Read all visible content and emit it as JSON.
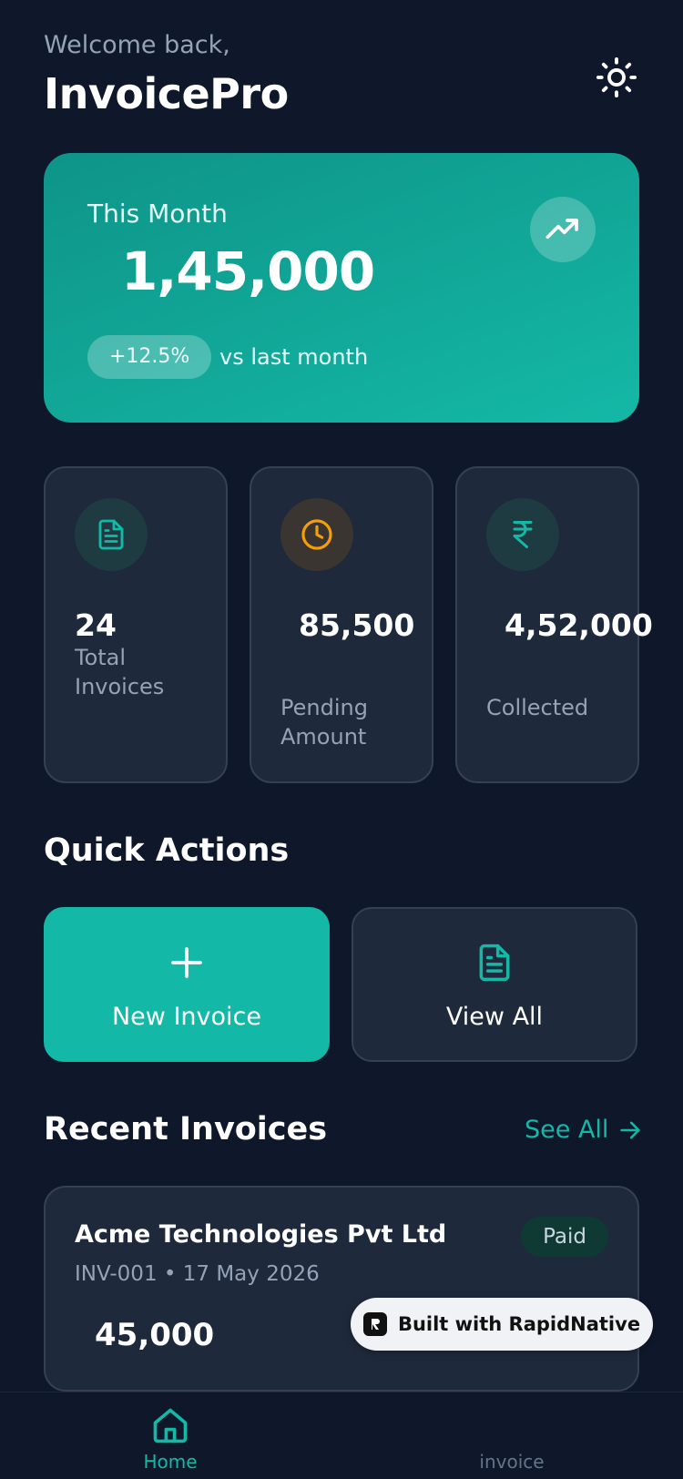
{
  "header": {
    "welcome": "Welcome back,",
    "title": "InvoicePro",
    "theme_icon": "sun-icon"
  },
  "hero": {
    "label": "This Month",
    "amount": "1,45,000",
    "change": "+12.5%",
    "compare": "vs last month",
    "icon": "trending-up-icon"
  },
  "stats": [
    {
      "value": "24",
      "label": "Total Invoices",
      "icon": "document-icon",
      "color": "#14b8a6"
    },
    {
      "value": "85,500",
      "label": "Pending Amount",
      "icon": "clock-icon",
      "color": "#f59e0b"
    },
    {
      "value": "4,52,000",
      "label": "Collected",
      "icon": "rupee-icon",
      "color": "#14b8a6"
    }
  ],
  "quick_actions": {
    "title": "Quick Actions",
    "new_invoice": "New Invoice",
    "view_all": "View All"
  },
  "recent": {
    "title": "Recent Invoices",
    "see_all": "See All",
    "invoices": [
      {
        "client": "Acme Technologies Pvt Ltd",
        "meta": "INV-001 • 17 May 2026",
        "amount": "45,000",
        "status": "Paid"
      }
    ]
  },
  "badge": {
    "text": "Built with RapidNative"
  },
  "nav": {
    "items": [
      {
        "label": "Home",
        "icon": "home-icon",
        "active": true
      },
      {
        "label": "invoice",
        "icon": "",
        "active": false
      }
    ]
  },
  "colors": {
    "accent": "#14b8a6",
    "background": "#0f172a",
    "card": "#1e293b",
    "warning": "#f59e0b"
  }
}
